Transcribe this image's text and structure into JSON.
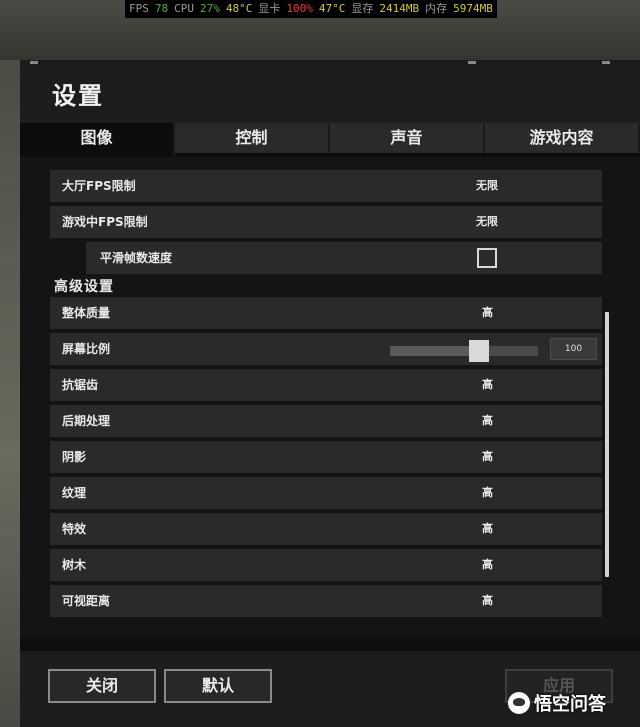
{
  "overlay": {
    "fps_label": "FPS",
    "fps_value": "78",
    "cpu_label": "CPU",
    "cpu_usage": "27%",
    "cpu_temp": "48°C",
    "gpu_label": "显卡",
    "gpu_usage": "100%",
    "gpu_temp": "47°C",
    "vram_label": "显存",
    "vram_value": "2414MB",
    "ram_label": "内存",
    "ram_value": "5974MB"
  },
  "dialog": {
    "title": "设置",
    "tabs": [
      {
        "label": "图像",
        "active": true
      },
      {
        "label": "控制",
        "active": false
      },
      {
        "label": "声音",
        "active": false
      },
      {
        "label": "游戏内容",
        "active": false
      }
    ]
  },
  "settings": {
    "lobby_fps": {
      "label": "大厅FPS限制",
      "value": "无限"
    },
    "ingame_fps": {
      "label": "游戏中FPS限制",
      "value": "无限"
    },
    "smooth_framerate": {
      "label": "平滑帧数速度",
      "checked": false
    },
    "advanced_title": "高级设置",
    "overall_quality": {
      "label": "整体质量",
      "value": "高"
    },
    "screen_scale": {
      "label": "屏幕比例",
      "value": "100",
      "level": 0.6
    },
    "antialiasing": {
      "label": "抗锯齿",
      "value": "高"
    },
    "post_processing": {
      "label": "后期处理",
      "value": "高"
    },
    "shadows": {
      "label": "阴影",
      "value": "高"
    },
    "textures": {
      "label": "纹理",
      "value": "高"
    },
    "effects": {
      "label": "特效",
      "value": "高"
    },
    "foliage": {
      "label": "树木",
      "value": "高"
    },
    "view_distance": {
      "label": "可视距离",
      "value": "高"
    }
  },
  "buttons": {
    "close": "关闭",
    "default": "默认",
    "apply": "应用"
  },
  "watermark": {
    "text": "悟空问答",
    "icon": "wukong-logo-icon"
  },
  "colors": {
    "fps_green": "#4caf3c",
    "cpu_yellow": "#d7c83a",
    "gpu_red": "#e04040",
    "dialog_bg": "#1d1d1d",
    "row_bg": "#2a2a2a"
  }
}
